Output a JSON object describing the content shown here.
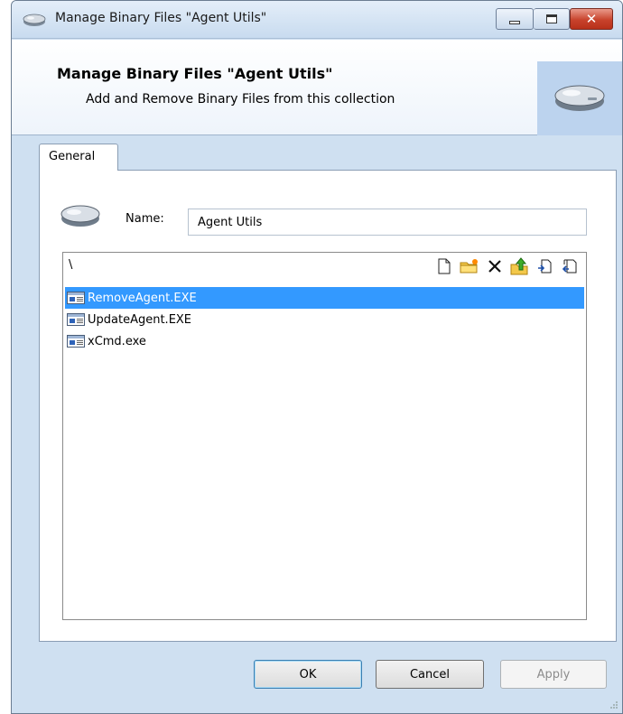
{
  "window": {
    "title": "Manage Binary Files \"Agent Utils\"",
    "close_glyph": "✕"
  },
  "header": {
    "title": "Manage Binary Files \"Agent Utils\"",
    "subtitle": "Add and Remove Binary Files from this collection",
    "icon": "hard-drive-icon"
  },
  "tabs": [
    {
      "label": "General",
      "active": true
    }
  ],
  "form": {
    "name_label": "Name:",
    "name_value": "Agent Utils"
  },
  "files": {
    "path": "\\",
    "toolbar": [
      {
        "name": "new-file-icon"
      },
      {
        "name": "new-folder-icon"
      },
      {
        "name": "delete-icon"
      },
      {
        "name": "up-folder-icon"
      },
      {
        "name": "import-icon"
      },
      {
        "name": "export-icon"
      }
    ],
    "items": [
      {
        "name": "RemoveAgent.EXE",
        "selected": true
      },
      {
        "name": "UpdateAgent.EXE",
        "selected": false
      },
      {
        "name": "xCmd.exe",
        "selected": false
      }
    ]
  },
  "buttons": {
    "ok": "OK",
    "cancel": "Cancel",
    "apply": "Apply",
    "apply_enabled": false
  },
  "colors": {
    "selection": "#3399ff",
    "header_icon_bg": "#bcd3ee",
    "window_frame": "#cfe0f1",
    "close_button": "#c8432c"
  }
}
